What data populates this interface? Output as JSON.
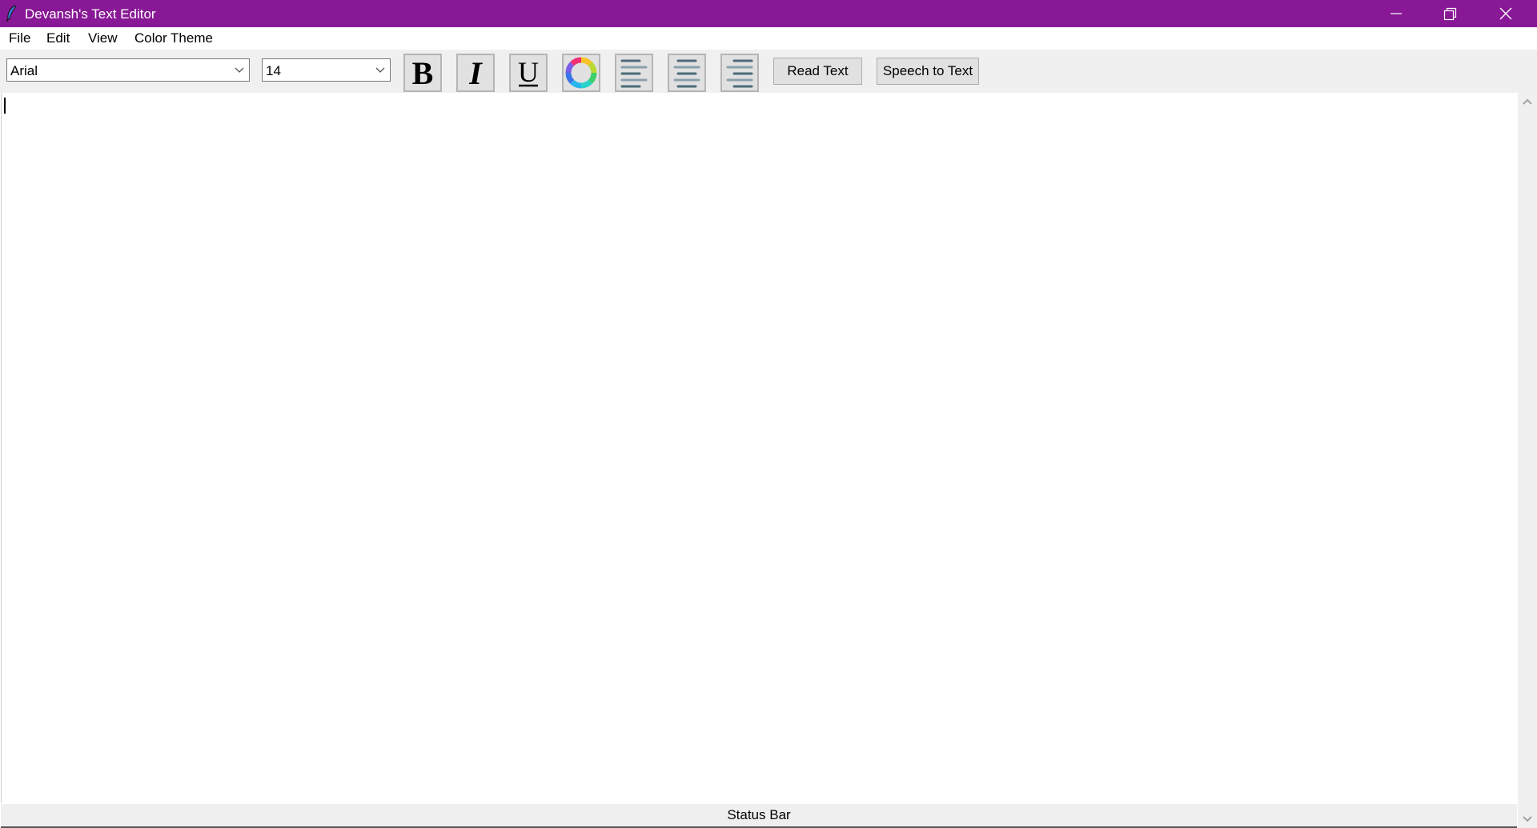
{
  "window": {
    "title": "Devansh's Text Editor",
    "title_bar_color": "#881896",
    "controls": [
      "minimize",
      "restore",
      "close"
    ]
  },
  "menu": {
    "items": [
      {
        "label": "File"
      },
      {
        "label": "Edit"
      },
      {
        "label": "View"
      },
      {
        "label": "Color Theme"
      }
    ]
  },
  "toolbar": {
    "font_family": {
      "value": "Arial"
    },
    "font_size": {
      "value": "14"
    },
    "buttons": {
      "bold": {
        "icon": "bold-icon",
        "glyph": "B"
      },
      "italic": {
        "icon": "italic-icon",
        "glyph": "I"
      },
      "underline": {
        "icon": "underline-icon",
        "glyph": "U"
      },
      "font_color": {
        "icon": "color-wheel-icon"
      },
      "align_left": {
        "icon": "align-left-icon"
      },
      "align_center": {
        "icon": "align-center-icon"
      },
      "align_right": {
        "icon": "align-right-icon"
      }
    },
    "read_text_label": "Read Text",
    "speech_to_text_label": "Speech to Text"
  },
  "editor": {
    "content": ""
  },
  "status_bar": {
    "text": "Status Bar"
  }
}
